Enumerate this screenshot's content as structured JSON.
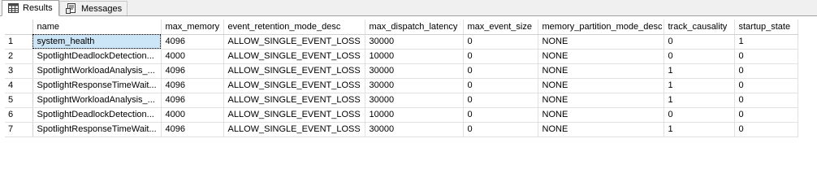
{
  "tabs": [
    {
      "label": "Results",
      "icon": "grid-icon",
      "active": true
    },
    {
      "label": "Messages",
      "icon": "messages-icon",
      "active": false
    }
  ],
  "grid": {
    "columns": [
      "name",
      "max_memory",
      "event_retention_mode_desc",
      "max_dispatch_latency",
      "max_event_size",
      "memory_partition_mode_desc",
      "track_causality",
      "startup_state"
    ],
    "rows": [
      {
        "num": "1",
        "cells": [
          "system_health",
          "4096",
          "ALLOW_SINGLE_EVENT_LOSS",
          "30000",
          "0",
          "NONE",
          "0",
          "1"
        ]
      },
      {
        "num": "2",
        "cells": [
          "SpotlightDeadlockDetection...",
          "4000",
          "ALLOW_SINGLE_EVENT_LOSS",
          "10000",
          "0",
          "NONE",
          "0",
          "0"
        ]
      },
      {
        "num": "3",
        "cells": [
          "SpotlightWorkloadAnalysis_...",
          "4096",
          "ALLOW_SINGLE_EVENT_LOSS",
          "30000",
          "0",
          "NONE",
          "1",
          "0"
        ]
      },
      {
        "num": "4",
        "cells": [
          "SpotlightResponseTimeWait...",
          "4096",
          "ALLOW_SINGLE_EVENT_LOSS",
          "30000",
          "0",
          "NONE",
          "1",
          "0"
        ]
      },
      {
        "num": "5",
        "cells": [
          "SpotlightWorkloadAnalysis_...",
          "4096",
          "ALLOW_SINGLE_EVENT_LOSS",
          "30000",
          "0",
          "NONE",
          "1",
          "0"
        ]
      },
      {
        "num": "6",
        "cells": [
          "SpotlightDeadlockDetection...",
          "4000",
          "ALLOW_SINGLE_EVENT_LOSS",
          "10000",
          "0",
          "NONE",
          "0",
          "0"
        ]
      },
      {
        "num": "7",
        "cells": [
          "SpotlightResponseTimeWait...",
          "4096",
          "ALLOW_SINGLE_EVENT_LOSS",
          "30000",
          "0",
          "NONE",
          "1",
          "0"
        ]
      }
    ]
  }
}
